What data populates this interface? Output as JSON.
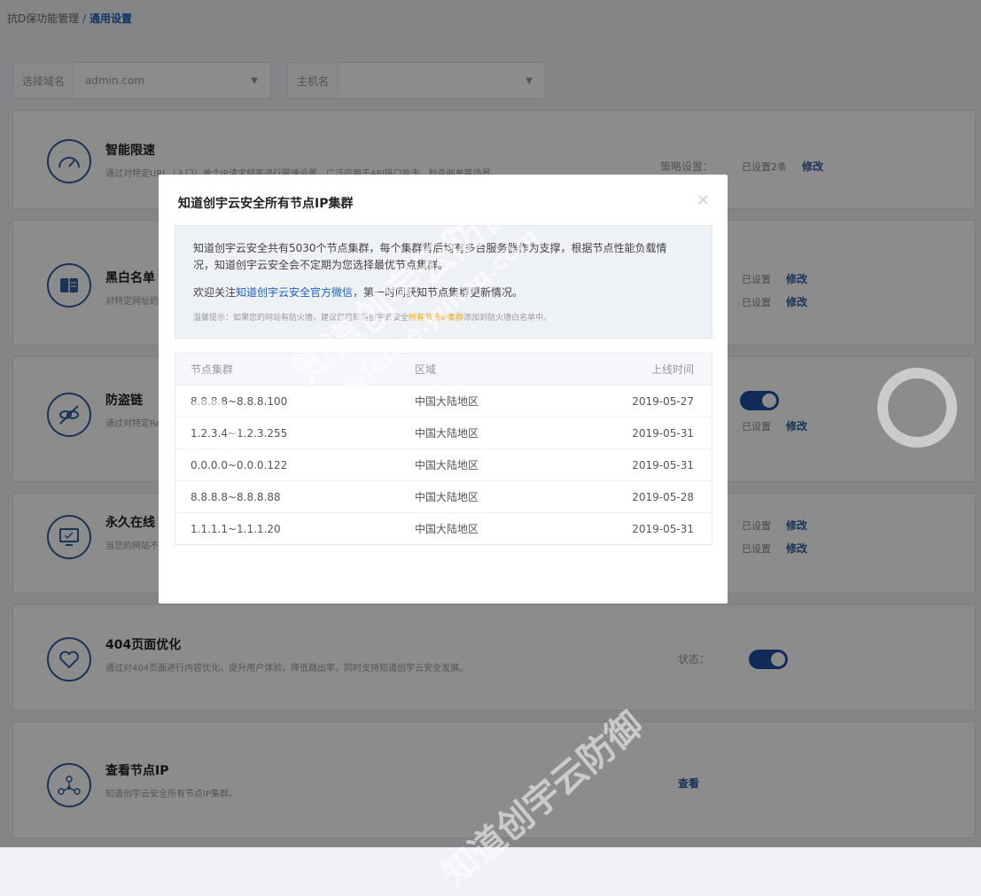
{
  "breadcrumb": {
    "parent": "抗D保功能管理",
    "sep": "/",
    "current": "通用设置"
  },
  "filters": {
    "domain": {
      "label": "选择域名",
      "value": "admin.com"
    },
    "host": {
      "label": "主机名",
      "value": ""
    }
  },
  "cards": {
    "speed": {
      "title": "智能限速",
      "desc": "通过对特定URL（入口）单个IP请求频率进行限速设置，广泛应用于API接口攻击、秒杀刷单等场景",
      "label": "策略设置：",
      "value": "已设置2条",
      "edit": "修改"
    },
    "blacklist": {
      "title": "黑白名单",
      "desc": "对特定网址的",
      "v1": "已设置",
      "e1": "修改",
      "v2": "已设置",
      "e2": "修改"
    },
    "hotlink": {
      "title": "防盗链",
      "desc": "通过对特定Re",
      "value": "已设置",
      "edit": "修改",
      "toggle_on": true
    },
    "online": {
      "title": "永久在线",
      "desc": "当您的网站不",
      "v1": "已设置",
      "e1": "修改",
      "v2": "已设置",
      "e2": "修改"
    },
    "page404": {
      "title": "404页面优化",
      "desc": "通过对404页面进行内容优化，提升用户体验，降低跳出率，同时支持知道创宇云安全发展。",
      "label": "状态：",
      "toggle_on": true
    },
    "nodeip": {
      "title": "查看节点IP",
      "desc": "知道创宇云安全所有节点IP集群。",
      "action": "查看"
    }
  },
  "modal": {
    "title": "知道创宇云安全所有节点IP集群",
    "close": "×",
    "info_line1": "知道创宇云安全共有5030个节点集群，每个集群背后均有多台服务器作为支撑，根据节点性能负载情况，知道创宇云安全会不定期为您选择最优节点集群。",
    "info_line2_pre": "欢迎关注",
    "info_line2_link": "知道创宇云安全官方微信",
    "info_line2_post": "，第一时间获知节点集群更新情况。",
    "tip_pre": "温馨提示：如果您的网站有防火墙，建议您将知道创宇云安全",
    "tip_hl": "所有节点IP集群",
    "tip_post": "添加到防火墙白名单中。",
    "table": {
      "headers": [
        "节点集群",
        "区域",
        "上线时间"
      ],
      "rows": [
        [
          "8.8.8.8~8.8.8.100",
          "中国大陆地区",
          "2019-05-27"
        ],
        [
          "1.2.3.4~1.2.3.255",
          "中国大陆地区",
          "2019-05-31"
        ],
        [
          "0.0.0.0~0.0.0.122",
          "中国大陆地区",
          "2019-05-31"
        ],
        [
          "8.8.8.8~8.8.8.88",
          "中国大陆地区",
          "2019-05-28"
        ],
        [
          "1.1.1.1~1.1.1.20",
          "中国大陆地区",
          "2019-05-31"
        ]
      ]
    }
  },
  "watermark": {
    "text1": "知道创宇云防御",
    "text2": "defense.yunaq.com"
  },
  "colors": {
    "accent": "#1f4fa0",
    "link": "#1f5fbf",
    "highlight": "#f5a623"
  }
}
